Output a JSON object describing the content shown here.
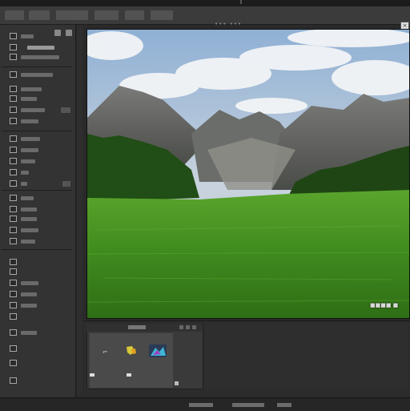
{
  "app": {
    "document_title": "••• •••",
    "zoom_readout": "■■■■ ■"
  },
  "menu": {
    "items": [
      "",
      "",
      "",
      "",
      "",
      ""
    ]
  },
  "tools": {
    "icons": [
      "layers-icon",
      "eye-icon",
      "brush-icon",
      "crop-icon",
      "text-icon",
      "shape-icon",
      "eyedropper-icon",
      "eraser-icon"
    ]
  },
  "layers": {
    "layer_glyph": "⌐",
    "thumb_colors": [
      "#3e3e3e",
      "#2a3e5a"
    ]
  },
  "colors": {
    "background": "#2a2a2a",
    "panel": "#333333",
    "menubar": "#3b3b3b",
    "sky": "#b9c8da",
    "meadow": "#4d9624",
    "forest": "#1f4514"
  }
}
